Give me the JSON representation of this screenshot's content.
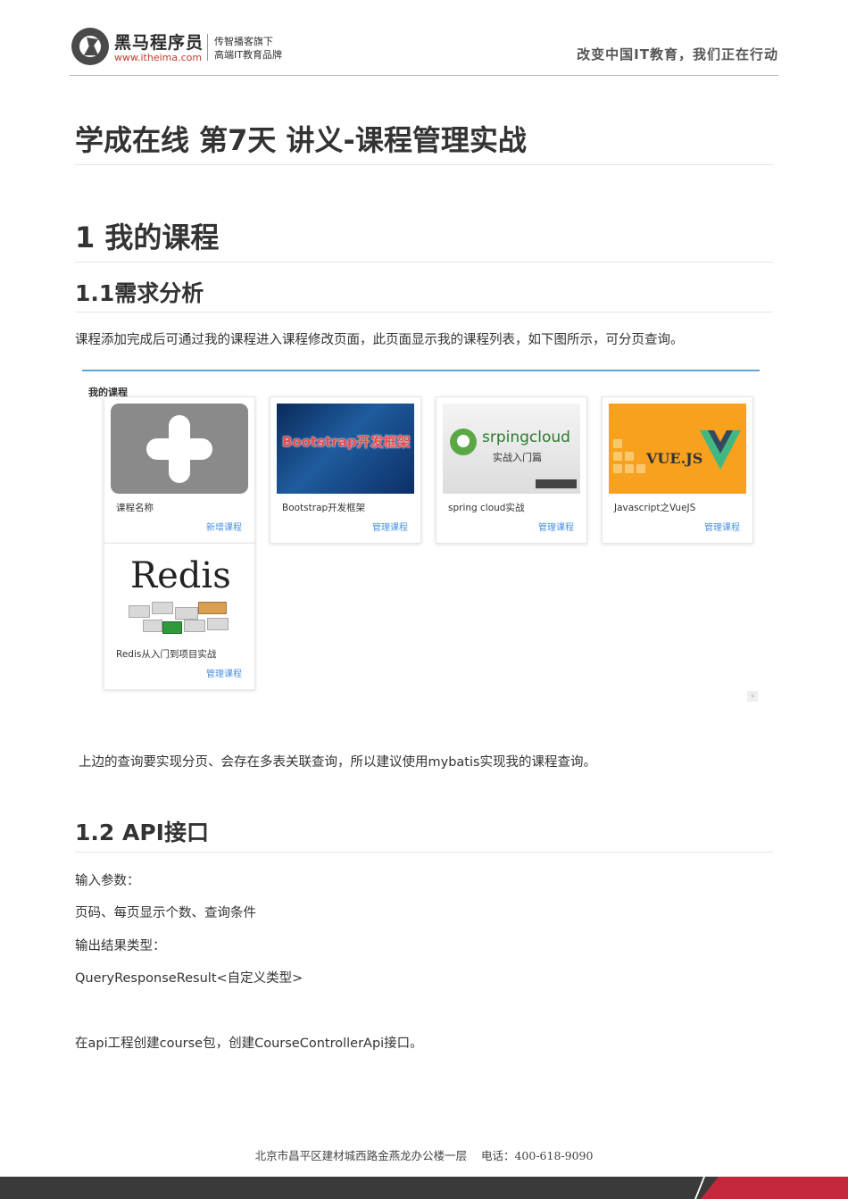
{
  "header": {
    "brand_name": "黑马程序员",
    "brand_url": "www.itheima.com",
    "tagline_1": "传智播客旗下",
    "tagline_2": "高端IT教育品牌",
    "slogan": "改变中国IT教育，我们正在行动"
  },
  "doc": {
    "title": "学成在线 第7天 讲义-课程管理实战",
    "h1": "1 我的课程",
    "h2_1": "1.1需求分析",
    "p_intro": "课程添加完成后可通过我的课程进入课程修改页面，此页面显示我的课程列表，如下图所示，可分页查询。",
    "p_query": "上边的查询要实现分页、会存在多表关联查询，所以建议使用mybatis实现我的课程查询。",
    "h2_2": "1.2 API接口",
    "p_in_label": "输入参数：",
    "p_in_value": "页码、每页显示个数、查询条件",
    "p_out_label": "输出结果类型：",
    "p_out_value": "QueryResponseResult<自定义类型>",
    "p_create": "在api工程创建course包，创建CourseControllerApi接口。"
  },
  "screenshot": {
    "title": "我的课程",
    "scroll_glyph": "‹",
    "cards": [
      {
        "name": "课程名称",
        "action": "新增课程"
      },
      {
        "name": "Bootstrap开发框架",
        "action": "管理课程",
        "thumb_text": "Bootstrap开发框架"
      },
      {
        "name": "spring cloud实战",
        "action": "管理课程",
        "thumb_text": "srpingcloud",
        "thumb_sub": "实战入门篇"
      },
      {
        "name": "Javascript之VueJS",
        "action": "管理课程",
        "thumb_text": "VUE.JS"
      },
      {
        "name": "Redis从入门到项目实战",
        "action": "管理课程",
        "thumb_text": "Redis"
      }
    ]
  },
  "footer": {
    "address": "北京市昌平区建材城西路金燕龙办公楼一层    电话：400-618-9090"
  },
  "colors": {
    "link": "#4a90e2",
    "accent_bar": "#5da7d9",
    "footer_red": "#c5283d"
  }
}
